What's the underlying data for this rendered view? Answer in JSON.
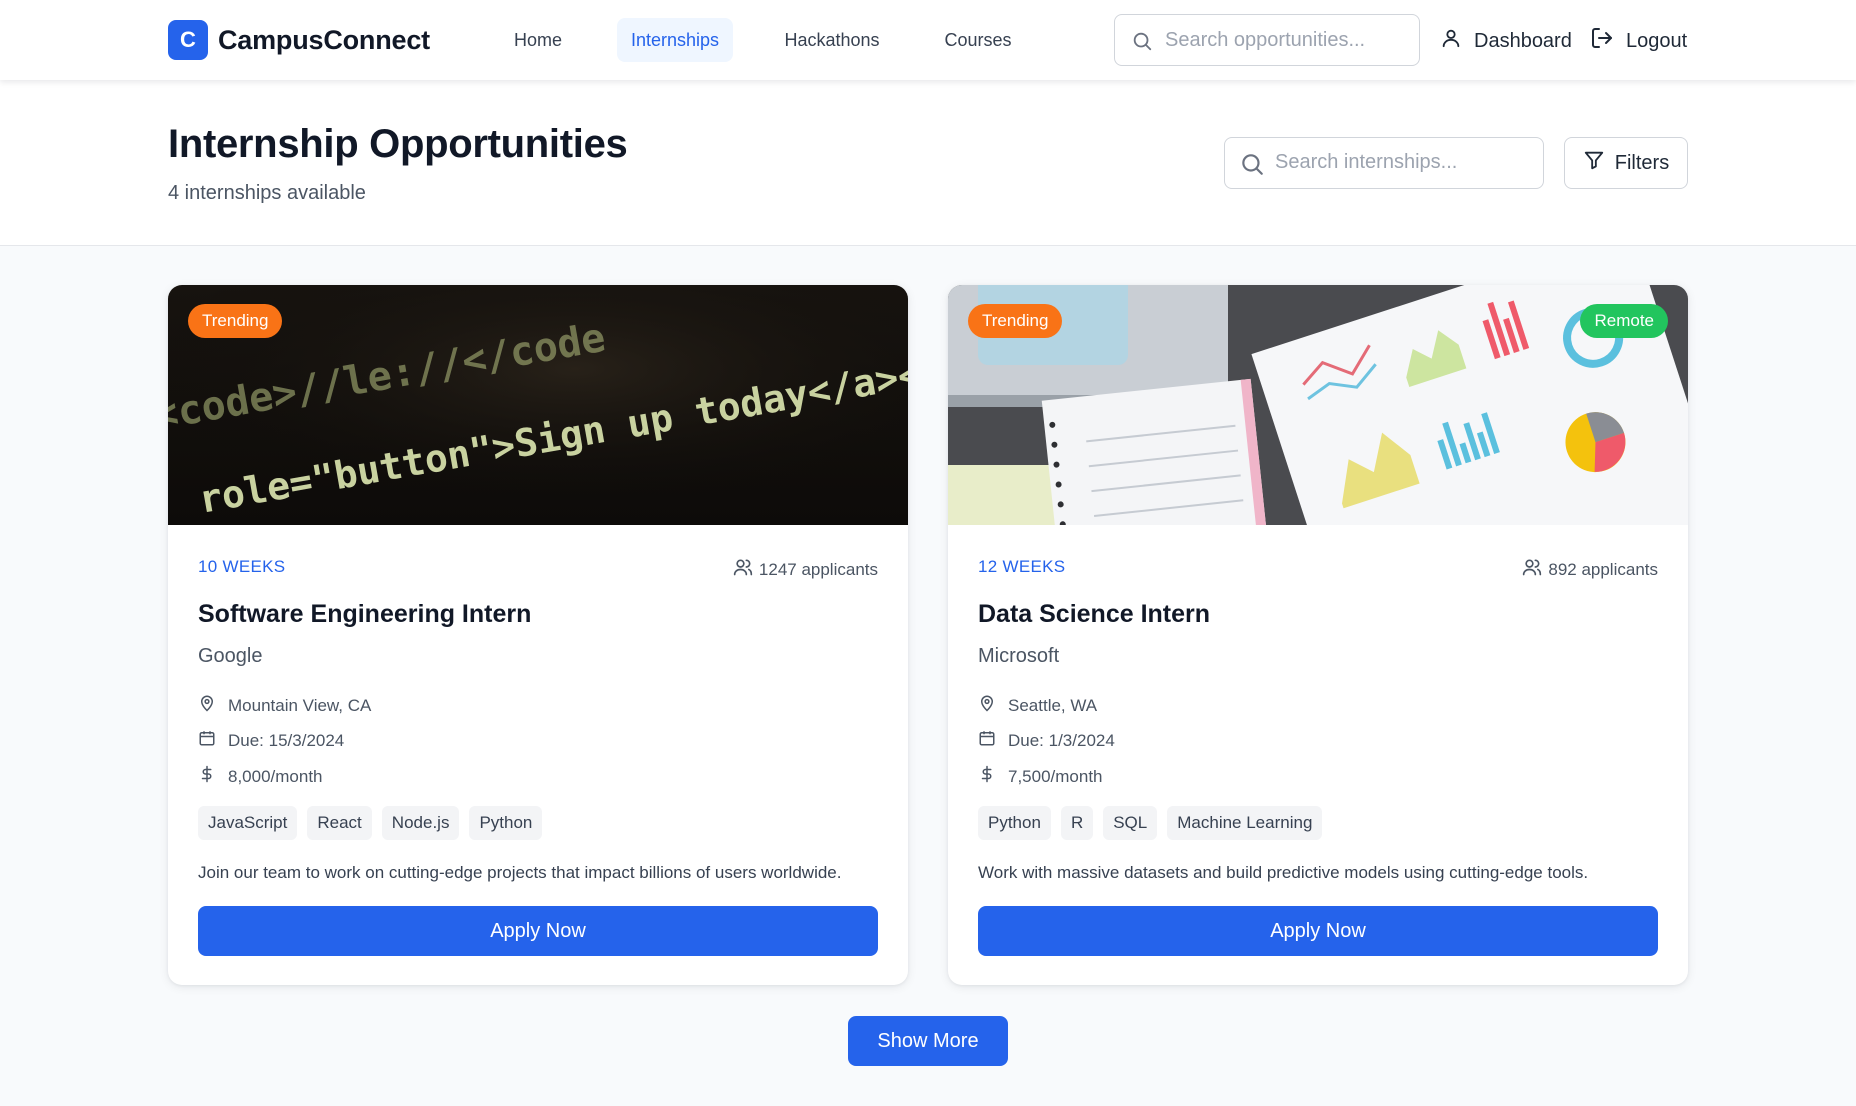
{
  "app": {
    "logo_letter": "C",
    "name": "CampusConnect",
    "brand_color": "#2563eb"
  },
  "nav": {
    "links": [
      {
        "label": "Home",
        "active": false
      },
      {
        "label": "Internships",
        "active": true
      },
      {
        "label": "Hackathons",
        "active": false
      },
      {
        "label": "Courses",
        "active": false
      }
    ],
    "search_placeholder": "Search opportunities...",
    "dashboard_label": "Dashboard",
    "logout_label": "Logout",
    "icons": {
      "search": "search-icon",
      "dashboard": "user-icon",
      "logout": "logout-icon"
    }
  },
  "header": {
    "title": "Internship Opportunities",
    "subtitle": "4 internships available",
    "search_placeholder": "Search internships...",
    "filters_label": "Filters"
  },
  "cards": [
    {
      "badges": [
        {
          "label": "Trending",
          "color": "#f97316"
        }
      ],
      "image": "code-on-dark-screen",
      "duration": "10 WEEKS",
      "applicants": "1247 applicants",
      "title": "Software Engineering Intern",
      "company": "Google",
      "location": "Mountain View, CA",
      "due": "Due: 15/3/2024",
      "stipend": "8,000/month",
      "skills": [
        "JavaScript",
        "React",
        "Node.js",
        "Python"
      ],
      "description": "Join our team to work on cutting-edge projects that impact billions of users worldwide.",
      "apply_label": "Apply Now"
    },
    {
      "badges": [
        {
          "label": "Trending",
          "color": "#f97316"
        },
        {
          "label": "Remote",
          "color": "#22c55e"
        }
      ],
      "image": "analytics-charts-on-desk",
      "duration": "12 WEEKS",
      "applicants": "892 applicants",
      "title": "Data Science Intern",
      "company": "Microsoft",
      "location": "Seattle, WA",
      "due": "Due: 1/3/2024",
      "stipend": "7,500/month",
      "skills": [
        "Python",
        "R",
        "SQL",
        "Machine Learning"
      ],
      "description": "Work with massive datasets and build predictive models using cutting-edge tools.",
      "apply_label": "Apply Now"
    }
  ],
  "image_text": {
    "code_lines": [
      "<code>//le://</code",
      "role=\"button\">Sign up today</a></p>"
    ]
  },
  "show_more_label": "Show More"
}
